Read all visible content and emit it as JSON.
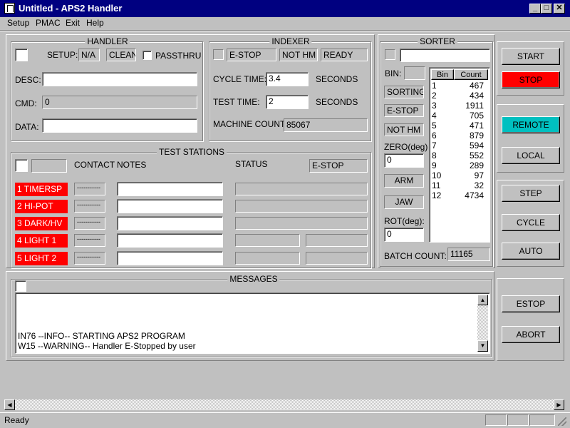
{
  "window": {
    "title": "Untitled - APS2 Handler",
    "minimize": "_",
    "maximize": "□",
    "close": "✕"
  },
  "menu": [
    {
      "label": "Setup"
    },
    {
      "label": "PMAC"
    },
    {
      "label": "Exit"
    },
    {
      "label": "Help"
    }
  ],
  "handler": {
    "title": "HANDLER",
    "setup_label": "SETUP:",
    "setup_value": "N/A",
    "setup_state": "CLEAN",
    "passthru_label": "PASSTHRU",
    "desc_label": "DESC:",
    "desc_value": "",
    "cmd_label": "CMD:",
    "cmd_value": "0",
    "data_label": "DATA:",
    "data_value": ""
  },
  "indexer": {
    "title": "INDEXER",
    "status1": "E-STOP",
    "status2": "NOT HM",
    "status3": "READY",
    "cycle_time_label": "CYCLE TIME:",
    "cycle_time_value": "3.4",
    "cycle_unit": "SECONDS",
    "test_time_label": "TEST TIME:",
    "test_time_value": "2",
    "test_unit": "SECONDS",
    "machine_count_label": "MACHINE COUNT:",
    "machine_count_value": "85067"
  },
  "sorter": {
    "title": "SORTER",
    "bin_label": "BIN:",
    "status_sorting": "SORTING",
    "status_estop": "E-STOP",
    "status_nothm": "NOT HM",
    "zero_label": "ZERO(deg)",
    "zero_value": "0",
    "arm_label": "ARM",
    "jaw_label": "JAW",
    "rot_label": "ROT(deg):",
    "rot_value": "0",
    "batch_count_label": "BATCH COUNT:",
    "batch_count_value": "11165",
    "bin_header": "Bin",
    "count_header": "Count",
    "bins": [
      {
        "bin": "1",
        "count": "467"
      },
      {
        "bin": "2",
        "count": "434"
      },
      {
        "bin": "3",
        "count": "1911"
      },
      {
        "bin": "4",
        "count": "705"
      },
      {
        "bin": "5",
        "count": "471"
      },
      {
        "bin": "6",
        "count": "879"
      },
      {
        "bin": "7",
        "count": "594"
      },
      {
        "bin": "8",
        "count": "552"
      },
      {
        "bin": "9",
        "count": "289"
      },
      {
        "bin": "10",
        "count": "97"
      },
      {
        "bin": "11",
        "count": "32"
      },
      {
        "bin": "12",
        "count": "4734"
      }
    ]
  },
  "test_stations": {
    "title": "TEST STATIONS",
    "contact_header": "CONTACT",
    "notes_header": "NOTES",
    "status_header": "STATUS",
    "overall_status": "E-STOP",
    "stations": [
      {
        "label": "1 TIMERSP",
        "contact": "-----------"
      },
      {
        "label": "2 HI-POT",
        "contact": "-----------"
      },
      {
        "label": "3 DARK/HV",
        "contact": "-----------"
      },
      {
        "label": "4 LIGHT 1",
        "contact": "-----------"
      },
      {
        "label": "5 LIGHT 2",
        "contact": "-----------"
      }
    ]
  },
  "buttons": {
    "start": "START",
    "stop": "STOP",
    "remote": "REMOTE",
    "local": "LOCAL",
    "step": "STEP",
    "cycle": "CYCLE",
    "auto": "AUTO",
    "estop": "ESTOP",
    "abort": "ABORT"
  },
  "messages": {
    "title": "MESSAGES",
    "lines": [
      "IN76 --INFO-- STARTING APS2 PROGRAM",
      "W15 --WARNING-- Handler E-Stopped by user"
    ]
  },
  "statusbar": {
    "text": "Ready"
  },
  "colors": {
    "titlebar": "#000080",
    "stop": "#ff0000",
    "remote": "#00c0c0",
    "station_label": "#ff0000"
  }
}
